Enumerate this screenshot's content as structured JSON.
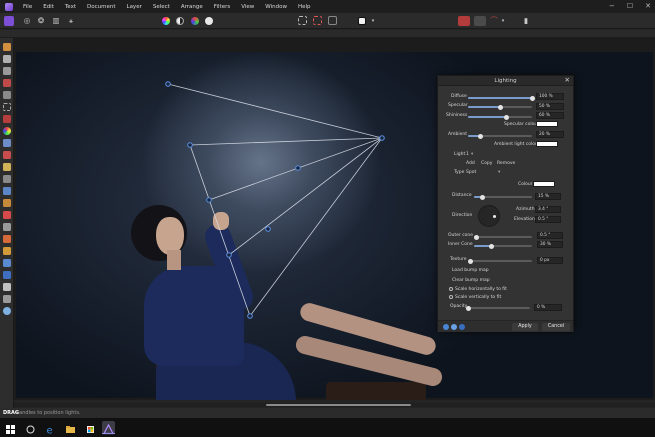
{
  "menu": {
    "items": [
      "File",
      "Edit",
      "Text",
      "Document",
      "Layer",
      "Select",
      "Arrange",
      "Filters",
      "View",
      "Window",
      "Help"
    ]
  },
  "window_controls": {
    "minimize": "−",
    "maximize": "☐",
    "close": "✕"
  },
  "status": {
    "key": "DRAG",
    "message": "handles to position lights."
  },
  "panel": {
    "title": "Lighting",
    "close": "✕",
    "diffuse": {
      "label": "Diffuse",
      "value": "100 %",
      "level": 1.0
    },
    "specular": {
      "label": "Specular",
      "value": "50 %",
      "level": 0.5
    },
    "shininess": {
      "label": "Shininess",
      "value": "60 %",
      "level": 0.6
    },
    "specular_colour_label": "Specular colour",
    "ambient": {
      "label": "Ambient",
      "value": "20 %",
      "level": 0.2
    },
    "ambient_colour_label": "Ambient light colour",
    "light_label": "Light",
    "light_value": "1",
    "add": "Add",
    "copy": "Copy",
    "remove": "Remove",
    "type_label": "Type",
    "type_value": "Spot",
    "colour_label": "Colour",
    "distance": {
      "label": "Distance",
      "value": "15 %",
      "level": 0.15
    },
    "direction_label": "Direction",
    "azimuth_label": "Azimuth",
    "azimuth_value": "3.4 °",
    "elevation_label": "Elevation",
    "elevation_value": "0.5 °",
    "outer_cone": {
      "label": "Outer cone",
      "value": "0.5 °",
      "level": 0.05
    },
    "inner_cone": {
      "label": "Inner Cone",
      "value": "30 %",
      "level": 0.3
    },
    "texture": {
      "label": "Texture",
      "value": "0 px",
      "level": 0.0
    },
    "load_bump": "Load bump map",
    "clear_bump": "Clear bump map",
    "scale_h": "Scale horizontally to fit",
    "scale_v": "Scale vertically to fit",
    "opacity": {
      "label": "Opacity",
      "value": "0 %",
      "level": 0.0
    },
    "apply": "Apply",
    "cancel": "Cancel"
  },
  "colors": {
    "accent": "#7a9ccc",
    "light_handle": "#5b8fe0",
    "brand": "#8a5be8"
  }
}
